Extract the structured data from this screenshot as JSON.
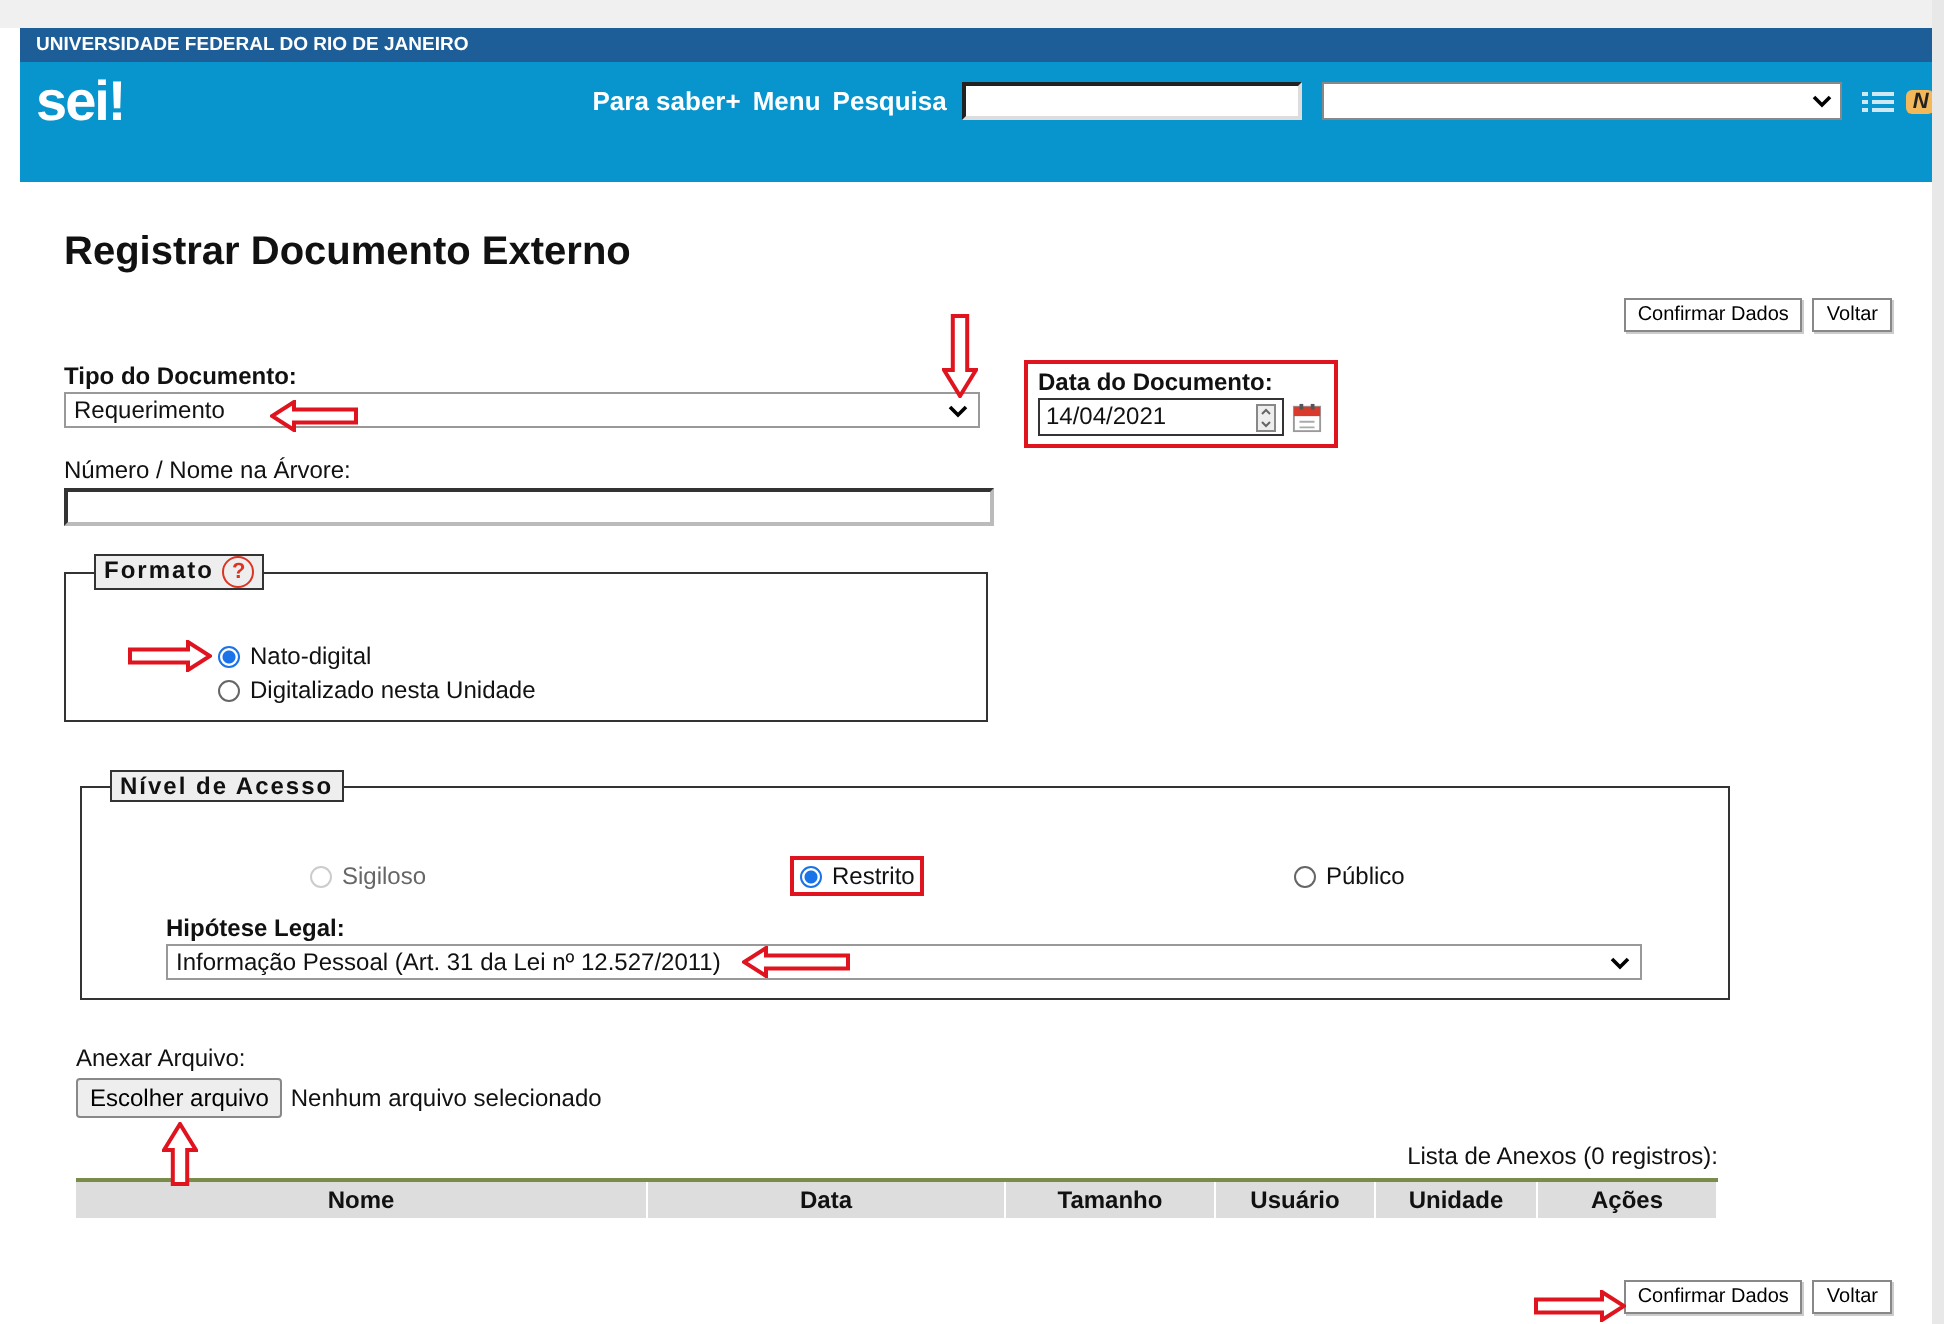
{
  "header": {
    "institution": "UNIVERSIDADE FEDERAL DO RIO DE JANEIRO",
    "logo": "sei!",
    "nav": [
      "Para saber+",
      "Menu",
      "Pesquisa"
    ],
    "badge": "N"
  },
  "title": "Registrar Documento Externo",
  "top_buttons": [
    "Confirmar Dados",
    "Voltar"
  ],
  "tipo": {
    "label": "Tipo do Documento:",
    "value": "Requerimento"
  },
  "data": {
    "label": "Data do Documento:",
    "value": "14/04/2021",
    "highlighted": true
  },
  "numero": {
    "label": "Número / Nome na Árvore:"
  },
  "formato": {
    "legend": "Formato",
    "help": "?",
    "options": [
      {
        "label": "Nato-digital",
        "selected": true,
        "disabled": false
      },
      {
        "label": "Digitalizado nesta Unidade",
        "selected": false,
        "disabled": false
      }
    ]
  },
  "nivel": {
    "legend": "Nível de Acesso",
    "options": [
      {
        "label": "Sigiloso",
        "selected": false,
        "disabled": true,
        "highlighted": false
      },
      {
        "label": "Restrito",
        "selected": true,
        "disabled": false,
        "highlighted": true
      },
      {
        "label": "Público",
        "selected": false,
        "disabled": false,
        "highlighted": false
      }
    ],
    "hipotese": {
      "label": "Hipótese Legal:",
      "value": "Informação Pessoal (Art. 31 da Lei nº 12.527/2011)"
    }
  },
  "anexar": {
    "label": "Anexar Arquivo:",
    "button": "Escolher arquivo",
    "status": "Nenhum arquivo selecionado",
    "caption": "Lista de Anexos (0 registros):",
    "columns": [
      "Nome",
      "Data",
      "Tamanho",
      "Usuário",
      "Unidade",
      "Ações"
    ]
  },
  "bottom_buttons": [
    "Confirmar Dados",
    "Voltar"
  ]
}
